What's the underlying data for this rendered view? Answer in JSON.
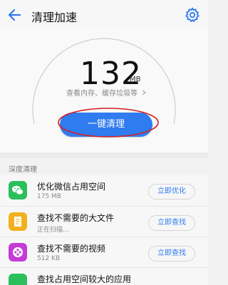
{
  "header": {
    "title": "清理加速"
  },
  "hero": {
    "value": "132",
    "unit": "MB",
    "subline": "查看内存、缓存垃圾等",
    "button_label": "一键清理"
  },
  "section": {
    "title": "深度清理"
  },
  "items": [
    {
      "title": "优化微信占用空间",
      "subtitle": "175 MB",
      "button": "立即优化",
      "icon": "wechat-icon",
      "color": "#2bbf5b"
    },
    {
      "title": "查找不需要的大文件",
      "subtitle": "正在扫描...",
      "button": "立即查找",
      "icon": "document-icon",
      "color": "#f2b01e"
    },
    {
      "title": "查找不需要的视频",
      "subtitle": "512 KB",
      "button": "立即查找",
      "icon": "video-reel-icon",
      "color": "#c43bd6"
    },
    {
      "title": "查找占用空间较大的应用",
      "subtitle": "",
      "button": "",
      "icon": "app-icon",
      "color": "#2bbf5b"
    }
  ],
  "colors": {
    "accent": "#2f7bf0",
    "annotation": "#d62020"
  }
}
